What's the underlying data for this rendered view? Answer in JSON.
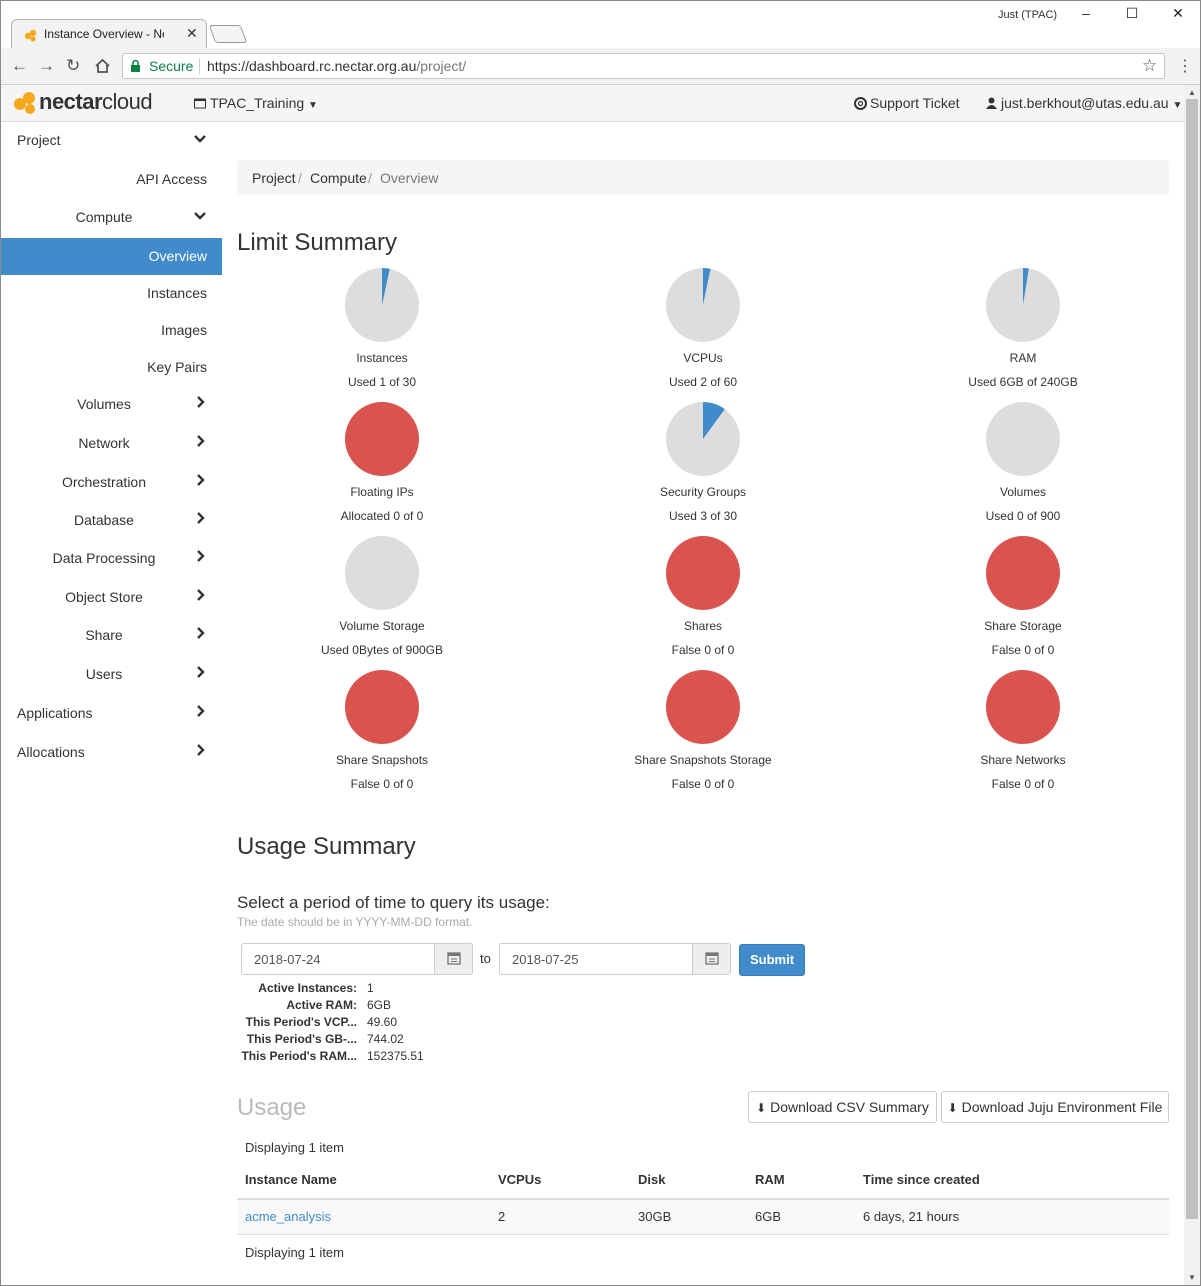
{
  "browser": {
    "tab_title": "Instance Overview - Nect",
    "tab_close": "✕",
    "window_user": "Just (TPAC)",
    "window_controls": {
      "minimize": "–",
      "maximize": "☐",
      "close": "✕"
    },
    "secure_label": "Secure",
    "url_scheme_host": "https://dashboard.rc.nectar.org.au",
    "url_path": "/project/"
  },
  "app": {
    "brand_bold": "nectar",
    "brand_light": "cloud",
    "project_selector": "TPAC_Training",
    "support": "Support Ticket",
    "user": "just.berkhout@utas.edu.au"
  },
  "sidebar": {
    "items": [
      {
        "label": "Project",
        "level": 0,
        "chevron": "down"
      },
      {
        "label": "API Access",
        "level": 2
      },
      {
        "label": "Compute",
        "level": 1,
        "chevron": "down"
      },
      {
        "label": "Overview",
        "level": 2,
        "active": true
      },
      {
        "label": "Instances",
        "level": 2
      },
      {
        "label": "Images",
        "level": 2
      },
      {
        "label": "Key Pairs",
        "level": 2
      },
      {
        "label": "Volumes",
        "level": 1,
        "chevron": "right"
      },
      {
        "label": "Network",
        "level": 1,
        "chevron": "right"
      },
      {
        "label": "Orchestration",
        "level": 1,
        "chevron": "right"
      },
      {
        "label": "Database",
        "level": 1,
        "chevron": "right"
      },
      {
        "label": "Data Processing",
        "level": 1,
        "chevron": "right"
      },
      {
        "label": "Object Store",
        "level": 1,
        "chevron": "right"
      },
      {
        "label": "Share",
        "level": 1,
        "chevron": "right"
      },
      {
        "label": "Users",
        "level": 1,
        "chevron": "right"
      },
      {
        "label": "Applications",
        "level": 0,
        "chevron": "right"
      },
      {
        "label": "Allocations",
        "level": 0,
        "chevron": "right"
      }
    ]
  },
  "breadcrumb": [
    "Project",
    "Compute",
    "Overview"
  ],
  "breadcrumb_sep": "/",
  "limit_summary": {
    "title": "Limit Summary",
    "colors": {
      "used": "#428bca",
      "free": "#dddddd",
      "full": "#d9534f"
    },
    "items": [
      {
        "name": "Instances",
        "status": "Used 1 of 30",
        "used": 1,
        "total": 30
      },
      {
        "name": "VCPUs",
        "status": "Used 2 of 60",
        "used": 2,
        "total": 60
      },
      {
        "name": "RAM",
        "status": "Used 6GB of 240GB",
        "used": 6,
        "total": 240
      },
      {
        "name": "Floating IPs",
        "status": "Allocated 0 of 0",
        "used": 0,
        "total": 0
      },
      {
        "name": "Security Groups",
        "status": "Used 3 of 30",
        "used": 3,
        "total": 30
      },
      {
        "name": "Volumes",
        "status": "Used 0 of 900",
        "used": 0,
        "total": 900
      },
      {
        "name": "Volume Storage",
        "status": "Used 0Bytes of 900GB",
        "used": 0,
        "total": 900
      },
      {
        "name": "Shares",
        "status": "False 0 of 0",
        "used": 0,
        "total": 0
      },
      {
        "name": "Share Storage",
        "status": "False 0 of 0",
        "used": 0,
        "total": 0
      },
      {
        "name": "Share Snapshots",
        "status": "False 0 of 0",
        "used": 0,
        "total": 0
      },
      {
        "name": "Share Snapshots Storage",
        "status": "False 0 of 0",
        "used": 0,
        "total": 0
      },
      {
        "name": "Share Networks",
        "status": "False 0 of 0",
        "used": 0,
        "total": 0
      }
    ]
  },
  "usage_summary": {
    "title": "Usage Summary",
    "query_title": "Select a period of time to query its usage:",
    "query_hint": "The date should be in YYYY-MM-DD format.",
    "start": "2018-07-24",
    "end": "2018-07-25",
    "to_label": "to",
    "submit": "Submit",
    "stats": [
      {
        "k": "Active Instances:",
        "v": "1"
      },
      {
        "k": "Active RAM:",
        "v": "6GB"
      },
      {
        "k": "This Period's VCP...",
        "v": "49.60"
      },
      {
        "k": "This Period's GB-...",
        "v": "744.02"
      },
      {
        "k": "This Period's RAM...",
        "v": "152375.51"
      }
    ]
  },
  "usage": {
    "title": "Usage",
    "download_csv": "Download CSV Summary",
    "download_juju": "Download Juju Environment File",
    "displaying_top": "Displaying 1 item",
    "displaying_bottom": "Displaying 1 item",
    "columns": [
      "Instance Name",
      "VCPUs",
      "Disk",
      "RAM",
      "Time since created"
    ],
    "rows": [
      [
        "acme_analysis",
        "2",
        "30GB",
        "6GB",
        "6 days, 21 hours"
      ]
    ]
  }
}
